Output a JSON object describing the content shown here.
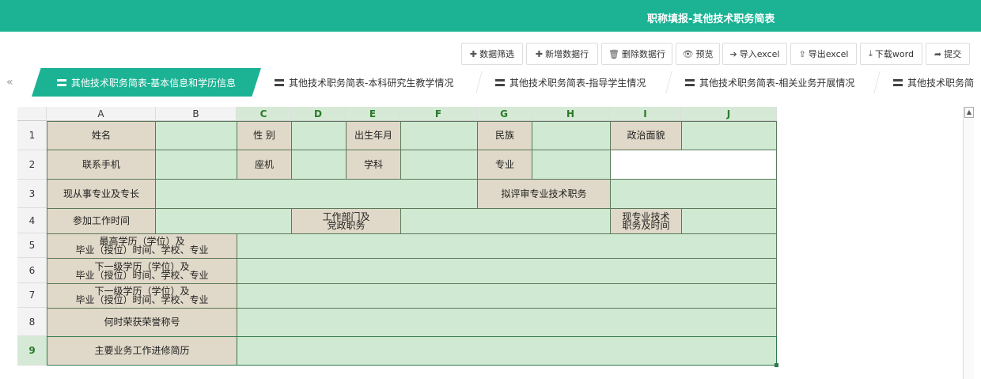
{
  "header": {
    "title": "职称填报-其他技术职务简表"
  },
  "toolbar": [
    {
      "label": "数据筛选",
      "icon": "plus-icon"
    },
    {
      "label": "新增数据行",
      "icon": "plus-icon"
    },
    {
      "label": "删除数据行",
      "icon": "trash-icon"
    },
    {
      "label": "预览",
      "icon": "eye-icon"
    },
    {
      "label": "导入excel",
      "icon": "import-icon"
    },
    {
      "label": "导出excel",
      "icon": "export-icon"
    },
    {
      "label": "下载word",
      "icon": "download-icon"
    },
    {
      "label": "提交",
      "icon": "submit-icon"
    }
  ],
  "tabs": [
    {
      "label": "其他技术职务简表-基本信息和学历信息",
      "active": true
    },
    {
      "label": "其他技术职务简表-本科研究生教学情况",
      "active": false
    },
    {
      "label": "其他技术职务简表-指导学生情况",
      "active": false
    },
    {
      "label": "其他技术职务简表-相关业务开展情况",
      "active": false
    },
    {
      "label": "其他技术职务简",
      "active": false
    }
  ],
  "tab_nav": "«",
  "columns": [
    "A",
    "B",
    "C",
    "D",
    "E",
    "F",
    "G",
    "H",
    "I",
    "J"
  ],
  "rows": [
    "1",
    "2",
    "3",
    "4",
    "5",
    "6",
    "7",
    "8",
    "9"
  ],
  "form": {
    "name": "姓名",
    "gender": "性 别",
    "birth": "出生年月",
    "ethnic": "民族",
    "political": "政治面貌",
    "phone": "联系手机",
    "landline": "座机",
    "subject": "学科",
    "major": "专业",
    "specialty": "现从事专业及专长",
    "proposed": "拟评审专业技术职务",
    "work_start": "参加工作时间",
    "dept_line1": "工作部门及",
    "dept_line2": "党政职务",
    "cur_line1": "现专业技术",
    "cur_line2": "职务及时间",
    "edu1_line1": "最高学历（学位）及",
    "edu1_line2": "毕业（授位）时间、学校、专业",
    "edu2_line1": "下一级学历（学位）及",
    "edu2_line2": "毕业（授位）时间、学校、专业",
    "edu3_line1": "下一级学历（学位）及",
    "edu3_line2": "毕业（授位）时间、学校、专业",
    "honor": "何时荣获荣誉称号",
    "resume": "主要业务工作进修简历"
  },
  "colors": {
    "accent": "#1bb394",
    "label_bg": "#e0d8c8",
    "input_bg": "#cfe9d2"
  }
}
